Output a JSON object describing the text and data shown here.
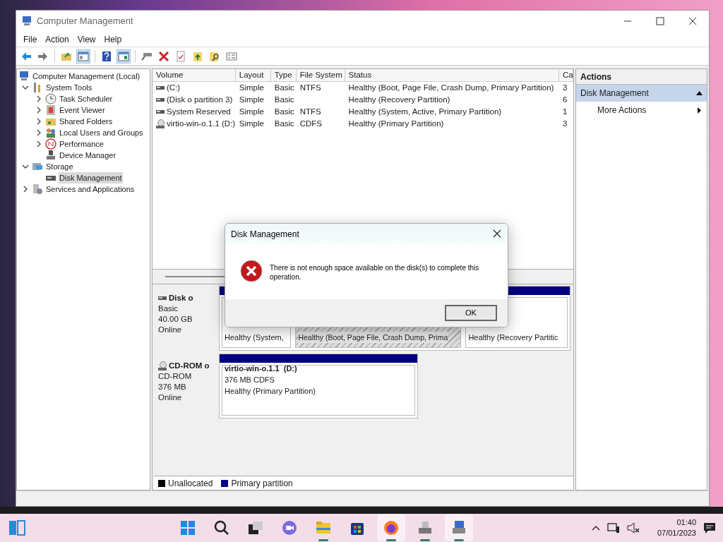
{
  "window": {
    "title": "Computer Management"
  },
  "menu": [
    "File",
    "Action",
    "View",
    "Help"
  ],
  "toolbar": [
    [
      {
        "kind": "back"
      },
      {
        "kind": "forward"
      }
    ],
    [
      {
        "kind": "up"
      },
      {
        "kind": "tree",
        "on": true
      }
    ],
    [
      {
        "kind": "help"
      },
      {
        "kind": "pane",
        "on": true
      }
    ],
    [
      {
        "kind": "connect"
      },
      {
        "kind": "delete"
      },
      {
        "kind": "check"
      },
      {
        "kind": "export"
      },
      {
        "kind": "find"
      },
      {
        "kind": "props"
      }
    ]
  ],
  "tree": [
    {
      "label": "Computer Management (Local)",
      "kind": "computer",
      "selected": false,
      "children": [
        {
          "label": "System Tools",
          "kind": "tools",
          "expanded": true,
          "selected": false,
          "children": [
            {
              "label": "Task Scheduler",
              "kind": "clock",
              "expanded": false,
              "selected": false
            },
            {
              "label": "Event Viewer",
              "kind": "log",
              "expanded": false,
              "selected": false
            },
            {
              "label": "Shared Folders",
              "kind": "folder",
              "expanded": false,
              "selected": false
            },
            {
              "label": "Local Users and Groups",
              "kind": "users",
              "expanded": false,
              "selected": false
            },
            {
              "label": "Performance",
              "kind": "gauge",
              "expanded": false,
              "selected": false
            },
            {
              "label": "Device Manager",
              "kind": "device",
              "selected": false
            }
          ]
        },
        {
          "label": "Storage",
          "kind": "storage",
          "expanded": true,
          "selected": false,
          "children": [
            {
              "label": "Disk Management",
              "kind": "disk",
              "selected": true
            }
          ]
        },
        {
          "label": "Services and Applications",
          "kind": "services",
          "expanded": false,
          "selected": false
        }
      ]
    }
  ],
  "volumes": {
    "columns": [
      "Volume",
      "Layout",
      "Type",
      "File System",
      "Status",
      "Ca"
    ],
    "rows": [
      {
        "kind": "drive",
        "cells": [
          " (C:)",
          "Simple",
          "Basic",
          "NTFS",
          "Healthy (Boot, Page File, Crash Dump, Primary Partition)",
          "3"
        ]
      },
      {
        "kind": "drive",
        "cells": [
          "(Disk o partition 3)",
          "Simple",
          "Basic",
          "",
          "Healthy (Recovery Partition)",
          "6"
        ]
      },
      {
        "kind": "drive",
        "cells": [
          "System Reserved",
          "Simple",
          "Basic",
          "NTFS",
          "Healthy (System, Active, Primary Partition)",
          "1"
        ]
      },
      {
        "kind": "cd",
        "cells": [
          "virtio-win-o.1.1 (D:)",
          "Simple",
          "Basic",
          "CDFS",
          "Healthy (Primary Partition)",
          "3"
        ]
      }
    ]
  },
  "disks": [
    {
      "kind": "disk",
      "name": "Disk o",
      "type": "Basic",
      "size": "40.00 GB",
      "state": "Online",
      "partitions": [
        {
          "status": "Healthy (System,",
          "selected": false
        },
        {
          "status": "Healthy (Boot, Page File, Crash Dump, Prima",
          "selected": true
        },
        {
          "status": "Healthy (Recovery Partitic",
          "selected": false
        }
      ]
    },
    {
      "kind": "cd",
      "name": "CD-ROM o",
      "type": "CD-ROM",
      "size": "376 MB",
      "state": "Online",
      "partitions": [
        {
          "name": "virtio-win-o.1.1  (D:)",
          "size": "376 MB CDFS",
          "status": "Healthy (Primary Partition)",
          "selected": false
        }
      ]
    }
  ],
  "legend": [
    {
      "label": "Unallocated",
      "color": "#000000"
    },
    {
      "label": "Primary partition",
      "color": "#000080"
    }
  ],
  "actions": {
    "title": "Actions",
    "section": "Disk Management",
    "items": [
      "More Actions"
    ]
  },
  "dialog": {
    "title": "Disk Management",
    "message": "There is not enough space available on the disk(s) to complete this operation.",
    "button": "OK"
  },
  "taskbar": {
    "apps": [
      {
        "kind": "start",
        "running": false,
        "selected": false
      },
      {
        "kind": "search",
        "running": false,
        "selected": false
      },
      {
        "kind": "taskview",
        "running": false,
        "selected": false
      },
      {
        "kind": "chat",
        "running": false,
        "selected": false
      },
      {
        "kind": "explorer",
        "running": true,
        "selected": false
      },
      {
        "kind": "store",
        "running": false,
        "selected": false
      },
      {
        "kind": "firefox",
        "running": true,
        "selected": true
      },
      {
        "kind": "app",
        "running": true,
        "selected": false
      },
      {
        "kind": "compmgmt",
        "running": true,
        "selected": true
      }
    ],
    "time": "01:40",
    "date": "07/01/2023"
  }
}
